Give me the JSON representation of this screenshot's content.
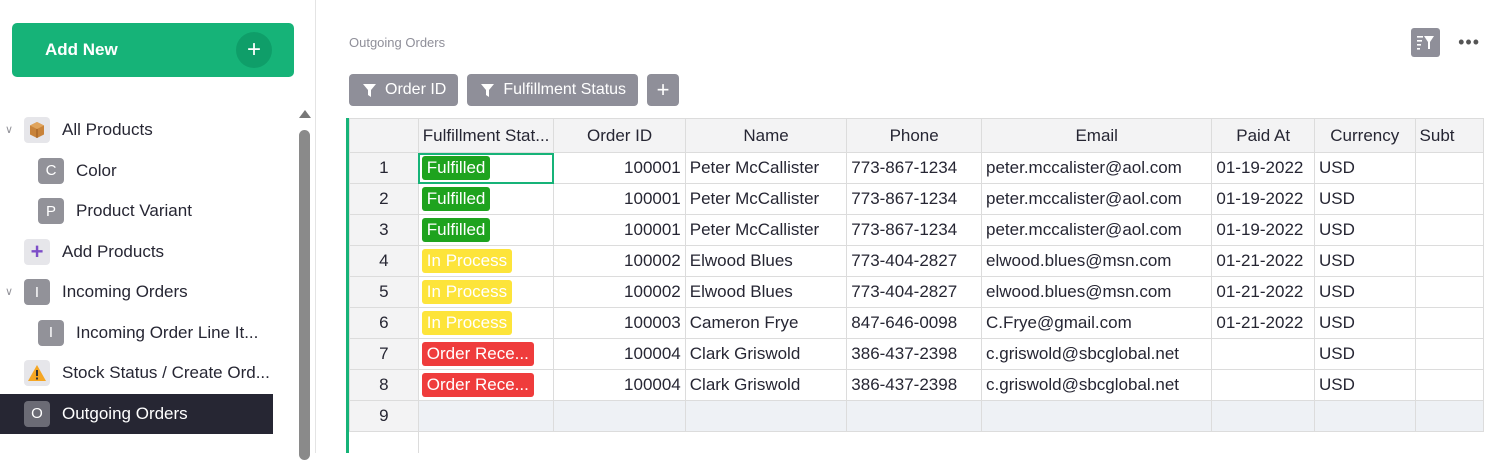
{
  "sidebar": {
    "add_new_label": "Add New",
    "items": [
      {
        "label": "All Products",
        "icon": "box-icon",
        "level": 0,
        "chevron": "expanded"
      },
      {
        "label": "Color",
        "icon_letter": "C",
        "level": 1
      },
      {
        "label": "Product Variant",
        "icon_letter": "P",
        "level": 1
      },
      {
        "label": "Add Products",
        "icon": "add-products-icon",
        "level": 0
      },
      {
        "label": "Incoming Orders",
        "icon_letter": "I",
        "level": 0,
        "chevron": "expanded"
      },
      {
        "label": "Incoming Order Line It...",
        "icon_letter": "I",
        "level": 1
      },
      {
        "label": "Stock Status / Create Ord...",
        "icon": "warning-icon",
        "level": 0
      },
      {
        "label": "Outgoing Orders",
        "icon_letter": "O",
        "level": 0,
        "active": true
      }
    ]
  },
  "page": {
    "title": "Outgoing Orders",
    "filters": [
      "Order ID",
      "Fulfillment Status"
    ]
  },
  "grid": {
    "columns": [
      "Fulfillment Stat...",
      "Order ID",
      "Name",
      "Phone",
      "Email",
      "Paid At",
      "Currency",
      "Subt"
    ],
    "rows": [
      {
        "n": "1",
        "status": "Fulfilled",
        "status_kind": "fulfilled",
        "order_id": "100001",
        "name": "Peter McCallister",
        "phone": "773-867-1234",
        "email": "peter.mccalister@aol.com",
        "paid_at": "01-19-2022",
        "currency": "USD"
      },
      {
        "n": "2",
        "status": "Fulfilled",
        "status_kind": "fulfilled",
        "order_id": "100001",
        "name": "Peter McCallister",
        "phone": "773-867-1234",
        "email": "peter.mccalister@aol.com",
        "paid_at": "01-19-2022",
        "currency": "USD"
      },
      {
        "n": "3",
        "status": "Fulfilled",
        "status_kind": "fulfilled",
        "order_id": "100001",
        "name": "Peter McCallister",
        "phone": "773-867-1234",
        "email": "peter.mccalister@aol.com",
        "paid_at": "01-19-2022",
        "currency": "USD"
      },
      {
        "n": "4",
        "status": "In Process",
        "status_kind": "process",
        "order_id": "100002",
        "name": "Elwood Blues",
        "phone": "773-404-2827",
        "email": "elwood.blues@msn.com",
        "paid_at": "01-21-2022",
        "currency": "USD"
      },
      {
        "n": "5",
        "status": "In Process",
        "status_kind": "process",
        "order_id": "100002",
        "name": "Elwood Blues",
        "phone": "773-404-2827",
        "email": "elwood.blues@msn.com",
        "paid_at": "01-21-2022",
        "currency": "USD"
      },
      {
        "n": "6",
        "status": "In Process",
        "status_kind": "process",
        "order_id": "100003",
        "name": "Cameron Frye",
        "phone": "847-646-0098",
        "email": "C.Frye@gmail.com",
        "paid_at": "01-21-2022",
        "currency": "USD"
      },
      {
        "n": "7",
        "status": "Order Rece...",
        "status_kind": "received",
        "order_id": "100004",
        "name": "Clark Griswold",
        "phone": "386-437-2398",
        "email": "c.griswold@sbcglobal.net",
        "paid_at": "",
        "currency": "USD"
      },
      {
        "n": "8",
        "status": "Order Rece...",
        "status_kind": "received",
        "order_id": "100004",
        "name": "Clark Griswold",
        "phone": "386-437-2398",
        "email": "c.griswold@sbcglobal.net",
        "paid_at": "",
        "currency": "USD"
      }
    ],
    "add_row_number": "9"
  },
  "colors": {
    "accent_green": "#16b378",
    "fulfilled": "#1ea31e",
    "in_process": "#fde43a",
    "order_received": "#ef3c3c",
    "active_nav": "#262633"
  }
}
